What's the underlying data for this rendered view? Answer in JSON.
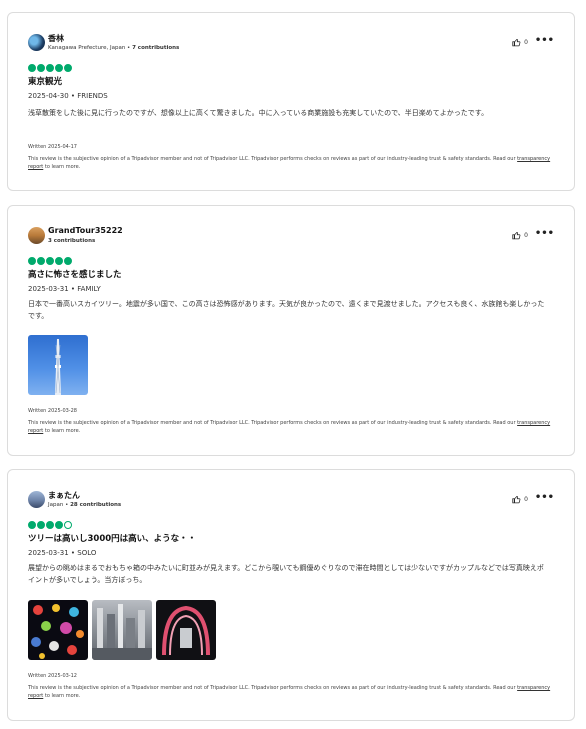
{
  "reviews": [
    {
      "username": "香林",
      "location": "Kanagawa Prefecture, Japan",
      "contributions": "7 contributions",
      "helpful_count": "0",
      "rating": 5,
      "title": "東京観光",
      "date": "2025-04-30",
      "trip_type": "FRIENDS",
      "text": "浅草散策をした後に見に行ったのですが、想像以上に高くて驚きました。中に入っている商業施設も充実していたので、半日楽めてよかったです。",
      "written": "Written 2025-04-17",
      "disclaimer_pre": "This review is the subjective opinion of a Tripadvisor member and not of Tripadvisor LLC. Tripadvisor performs checks on reviews as part of our industry-leading trust & safety standards. Read our ",
      "disclaimer_link": "transparency report",
      "disclaimer_post": " to learn more."
    },
    {
      "username": "GrandTour35222",
      "location": "",
      "contributions": "3 contributions",
      "helpful_count": "0",
      "rating": 5,
      "title": "高さに怖さを感じました",
      "date": "2025-03-31",
      "trip_type": "FAMILY",
      "text": "日本で一番高いスカイツリー。地震が多い国で、この高さは恐怖感があります。天気が良かったので、遠くまで見渡せました。アクセスも良く、水族館も楽しかったです。",
      "written": "Written 2025-03-28",
      "disclaimer_pre": "This review is the subjective opinion of a Tripadvisor member and not of Tripadvisor LLC. Tripadvisor performs checks on reviews as part of our industry-leading trust & safety standards. Read our ",
      "disclaimer_link": "transparency report",
      "disclaimer_post": " to learn more."
    },
    {
      "username": "まぁたん",
      "location": "Japan",
      "contributions": "28 contributions",
      "helpful_count": "0",
      "rating": 4,
      "title": "ツリーは高いし3000円は高い、ような・・",
      "date": "2025-03-31",
      "trip_type": "SOLO",
      "text": "展望からの眺めはまるでおもちゃ箱の中みたいに町並みが見えます。どこから覗いても鋼優めぐりなので滞在時間としては少ないですがカップルなどでは写真映えポイントが多いでしょう。当方ぼっち。",
      "written": "Written 2025-03-12",
      "disclaimer_pre": "This review is the subjective opinion of a Tripadvisor member and not of Tripadvisor LLC. Tripadvisor performs checks on reviews as part of our industry-leading trust & safety standards. Read our ",
      "disclaimer_link": "transparency report",
      "disclaimer_post": " to learn more."
    }
  ],
  "colors": {
    "bubble": "#00aa6c",
    "border": "#dcdcdc"
  },
  "icons": {
    "helpful": "thumbs-up-icon",
    "more": "more-options-icon"
  }
}
